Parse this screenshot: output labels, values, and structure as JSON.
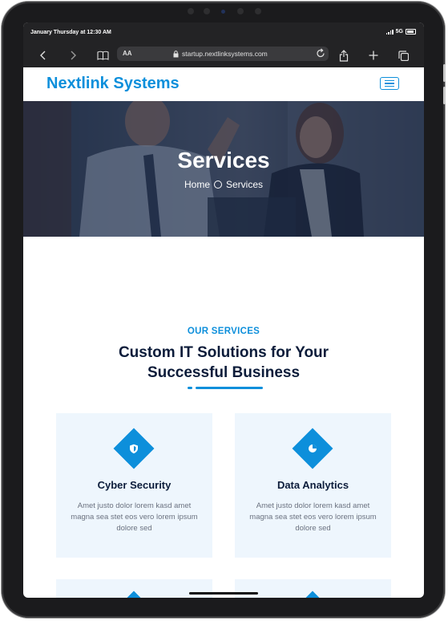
{
  "status_bar": {
    "time": "January Thursday at 12:30 AM",
    "network": "5G"
  },
  "browser": {
    "text_size_label": "AA",
    "url": "startup.nextlinksystems.com",
    "icons": [
      "back-icon",
      "forward-icon",
      "bookmarks-icon",
      "lock-icon",
      "reload-icon",
      "share-icon",
      "new-tab-icon",
      "tabs-icon"
    ]
  },
  "navbar": {
    "brand": "Nextlink Systems"
  },
  "hero": {
    "title": "Services",
    "breadcrumb": [
      "Home",
      "Services"
    ]
  },
  "services": {
    "eyebrow": "OUR SERVICES",
    "heading": "Custom IT Solutions for Your Successful Business",
    "cards": [
      {
        "title": "Cyber Security",
        "description": "Amet justo dolor lorem kasd amet magna sea stet eos vero lorem ipsum dolore sed",
        "icon": "shield-icon"
      },
      {
        "title": "Data Analytics",
        "description": "Amet justo dolor lorem kasd amet magna sea stet eos vero lorem ipsum dolore sed",
        "icon": "pie-chart-icon"
      }
    ]
  },
  "colors": {
    "accent": "#0d8fdb",
    "heading": "#0c1c3a",
    "card_bg": "#eef6fd"
  }
}
